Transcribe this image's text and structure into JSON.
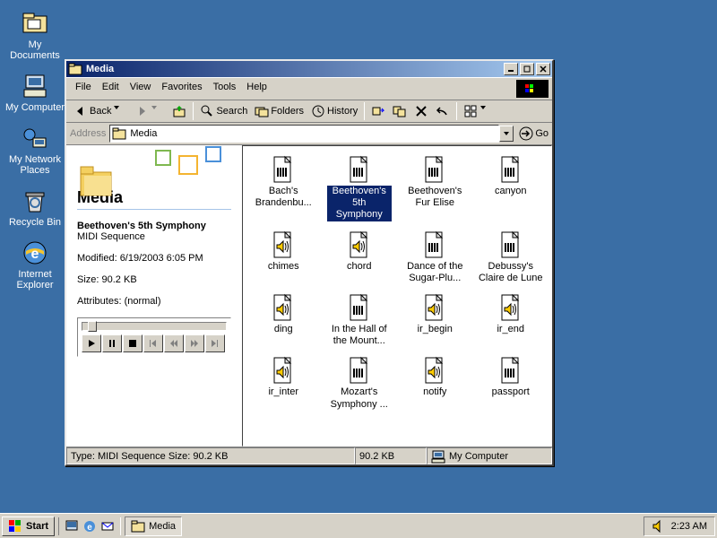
{
  "desktop": {
    "icons": [
      {
        "name": "my-documents",
        "label": "My Documents"
      },
      {
        "name": "my-computer",
        "label": "My Computer"
      },
      {
        "name": "network-places",
        "label": "My Network Places"
      },
      {
        "name": "recycle-bin",
        "label": "Recycle Bin"
      },
      {
        "name": "internet-explorer",
        "label": "Internet Explorer"
      }
    ]
  },
  "window": {
    "title": "Media",
    "menu": [
      "File",
      "Edit",
      "View",
      "Favorites",
      "Tools",
      "Help"
    ],
    "toolbar": {
      "back": "Back",
      "search": "Search",
      "folders": "Folders",
      "history": "History"
    },
    "address": {
      "label": "Address",
      "value": "Media",
      "go": "Go"
    },
    "info": {
      "folder_title": "Media",
      "sel_name": "Beethoven's 5th Symphony",
      "sel_type": "MIDI Sequence",
      "modified": "Modified: 6/19/2003 6:05 PM",
      "size": "Size: 90.2 KB",
      "attrs": "Attributes: (normal)"
    },
    "files": [
      {
        "label": "Bach's Brandenbu...",
        "type": "midi"
      },
      {
        "label": "Beethoven's 5th Symphony",
        "type": "midi",
        "selected": true
      },
      {
        "label": "Beethoven's Fur Elise",
        "type": "midi"
      },
      {
        "label": "canyon",
        "type": "midi"
      },
      {
        "label": "chimes",
        "type": "wav"
      },
      {
        "label": "chord",
        "type": "wav"
      },
      {
        "label": "Dance of the Sugar-Plu...",
        "type": "midi"
      },
      {
        "label": "Debussy's Claire de Lune",
        "type": "midi"
      },
      {
        "label": "ding",
        "type": "wav"
      },
      {
        "label": "In the Hall of the Mount...",
        "type": "midi"
      },
      {
        "label": "ir_begin",
        "type": "wav"
      },
      {
        "label": "ir_end",
        "type": "wav"
      },
      {
        "label": "ir_inter",
        "type": "wav"
      },
      {
        "label": "Mozart's Symphony ...",
        "type": "midi"
      },
      {
        "label": "notify",
        "type": "wav"
      },
      {
        "label": "passport",
        "type": "midi"
      }
    ],
    "status": {
      "left": "Type: MIDI Sequence Size: 90.2 KB",
      "mid": "90.2 KB",
      "right": "My Computer"
    }
  },
  "taskbar": {
    "start": "Start",
    "task": "Media",
    "clock": "2:23 AM"
  }
}
